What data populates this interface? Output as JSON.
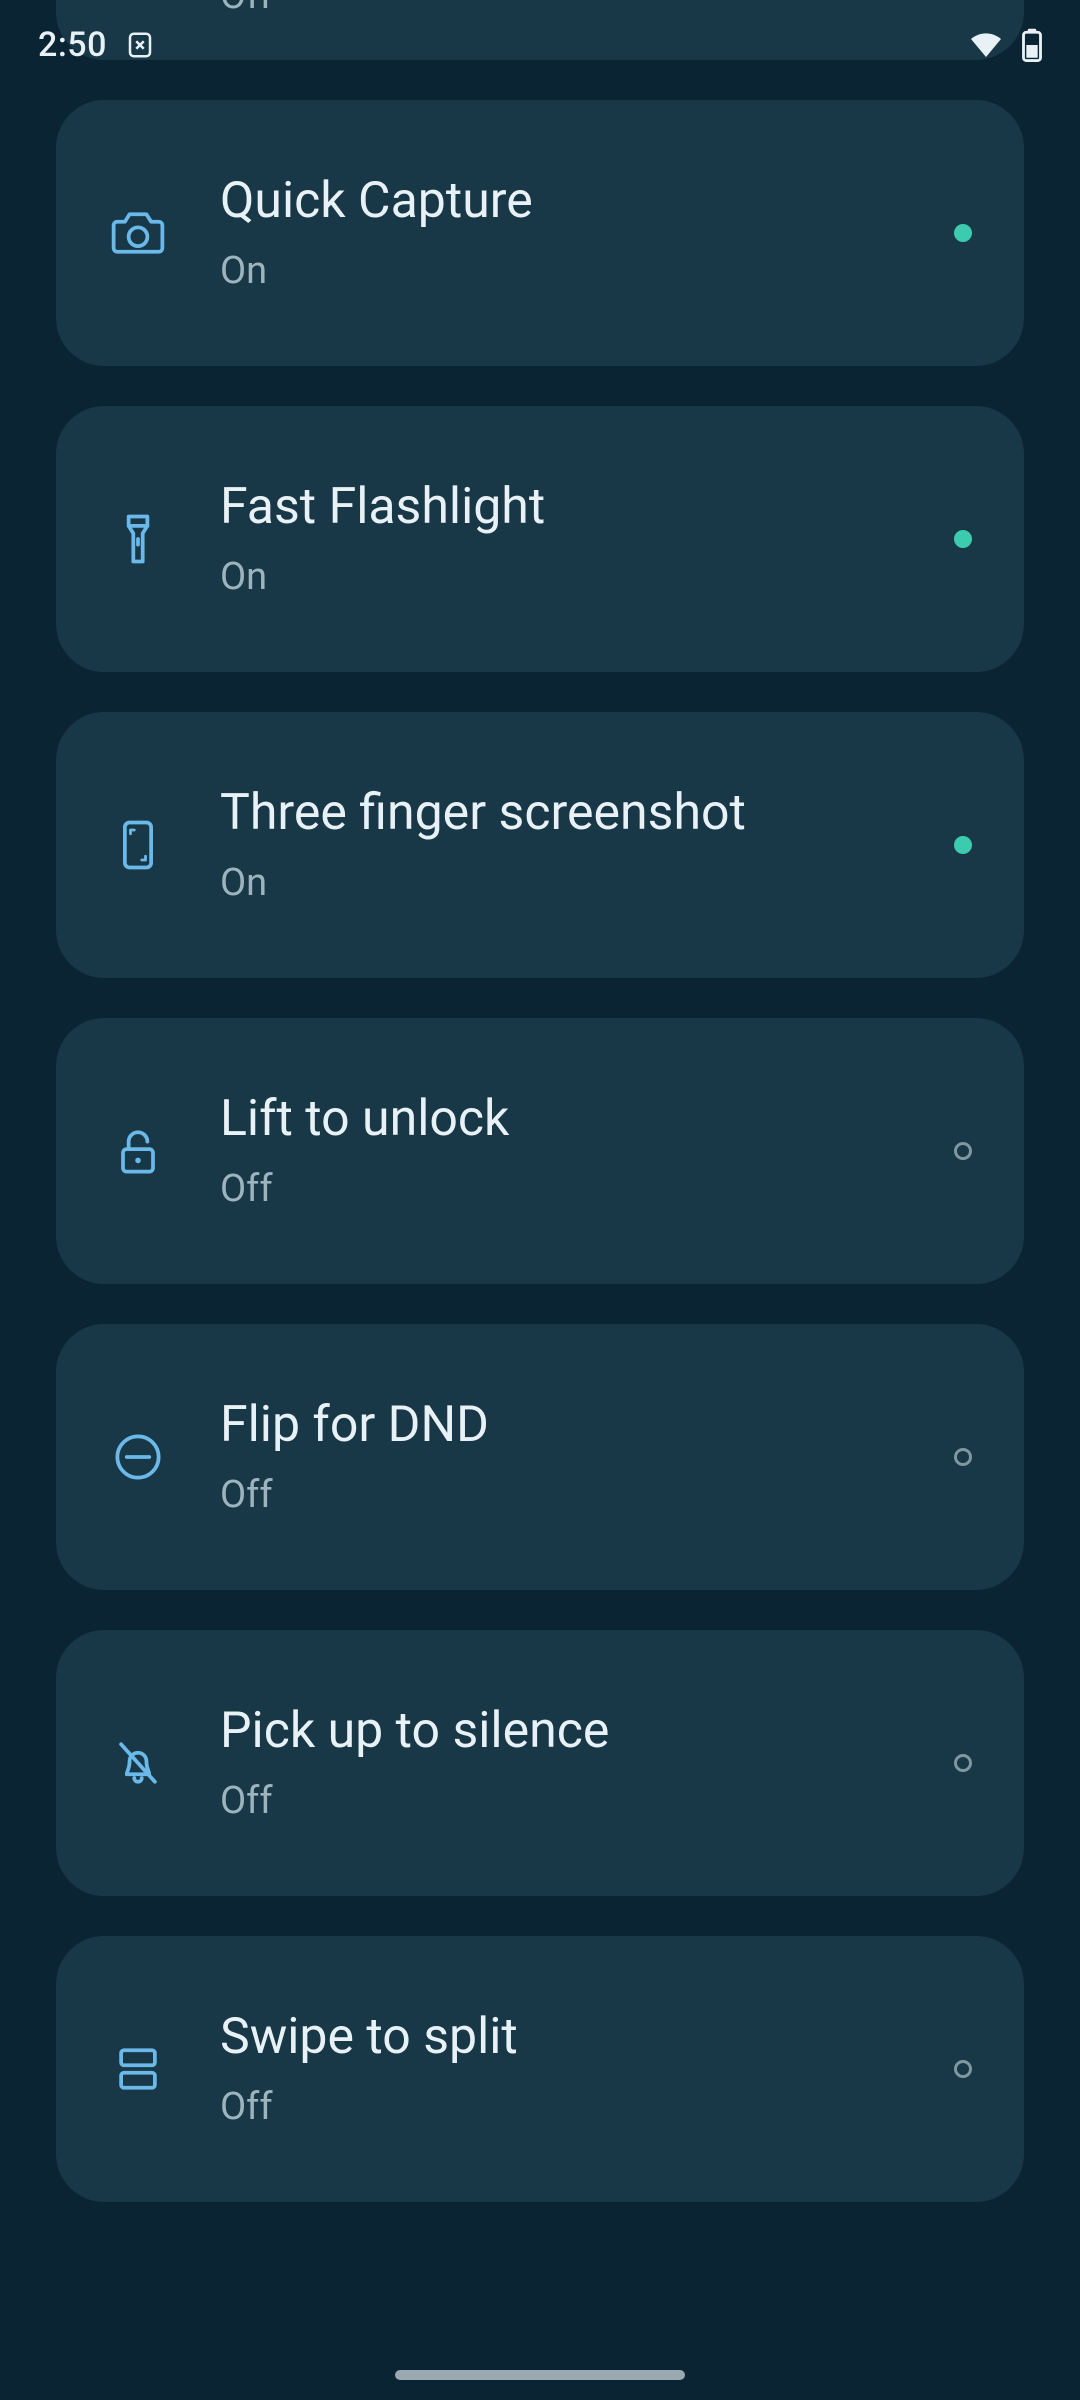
{
  "colors": {
    "bg": "#0a2434",
    "card": "#183747",
    "text": "#e8f1f5",
    "muted": "#9db4bf",
    "icon": "#6ab9e8",
    "dot_on": "#3CCBAE",
    "dot_off": "#7e97a1"
  },
  "statusbar": {
    "time": "2:50",
    "icons": [
      "saver-icon",
      "wifi-icon",
      "battery-icon"
    ]
  },
  "status_labels": {
    "on": "On",
    "off": "Off"
  },
  "items": [
    {
      "id": "prev-partial",
      "title": "",
      "status": "off",
      "icon": ""
    },
    {
      "id": "quick-capture",
      "title": "Quick Capture",
      "status": "on",
      "icon": "camera-icon"
    },
    {
      "id": "fast-flashlight",
      "title": "Fast Flashlight",
      "status": "on",
      "icon": "flashlight-icon"
    },
    {
      "id": "three-finger-screenshot",
      "title": "Three finger screenshot",
      "status": "on",
      "icon": "phone-screenshot-icon"
    },
    {
      "id": "lift-to-unlock",
      "title": "Lift to unlock",
      "status": "off",
      "icon": "unlock-icon"
    },
    {
      "id": "flip-for-dnd",
      "title": "Flip for DND",
      "status": "off",
      "icon": "dnd-icon"
    },
    {
      "id": "pick-up-to-silence",
      "title": "Pick up to silence",
      "status": "off",
      "icon": "bell-off-icon"
    },
    {
      "id": "swipe-to-split",
      "title": "Swipe to split",
      "status": "off",
      "icon": "split-icon"
    }
  ]
}
